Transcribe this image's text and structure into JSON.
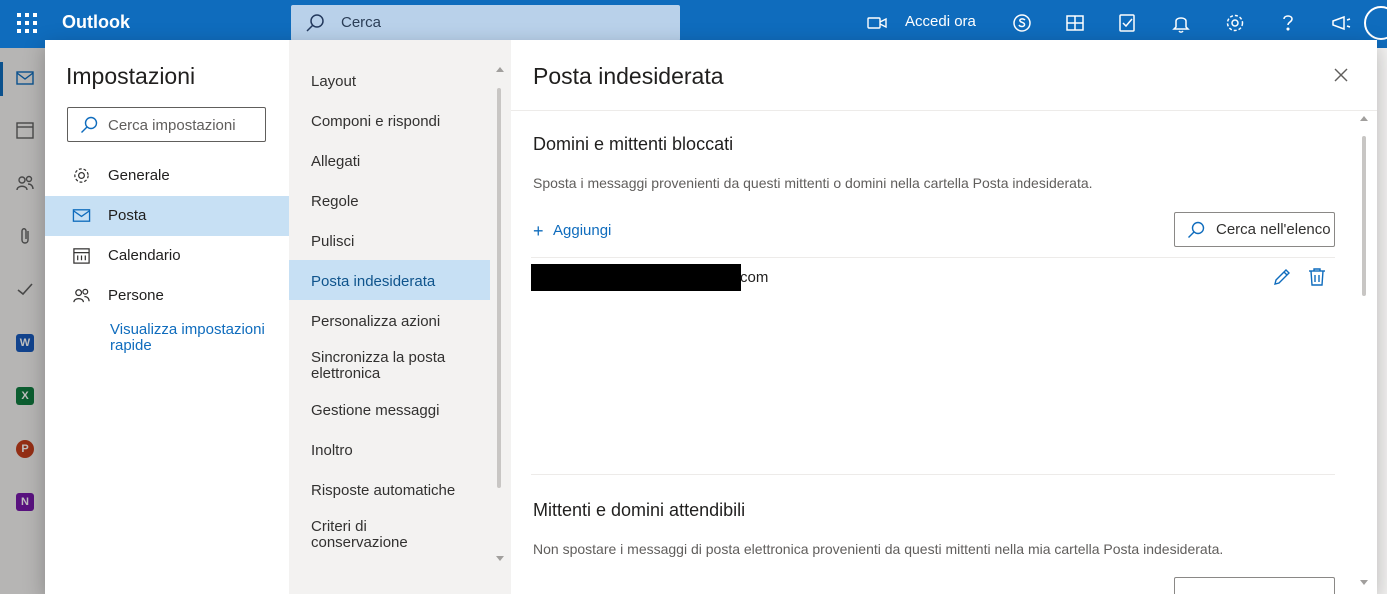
{
  "app": {
    "name": "Outlook",
    "search_placeholder": "Cerca",
    "accedi_label": "Accedi ora"
  },
  "settings": {
    "title": "Impostazioni",
    "search_placeholder": "Cerca impostazioni",
    "categories": [
      {
        "label": "Generale",
        "icon": "gear-icon",
        "selected": false
      },
      {
        "label": "Posta",
        "icon": "mail-icon",
        "selected": true
      },
      {
        "label": "Calendario",
        "icon": "calendar-icon",
        "selected": false
      },
      {
        "label": "Persone",
        "icon": "people-icon",
        "selected": false
      }
    ],
    "quick_link": "Visualizza impostazioni rapide"
  },
  "mail_sections": [
    "Layout",
    "Componi e rispondi",
    "Allegati",
    "Regole",
    "Pulisci",
    "Posta indesiderata",
    "Personalizza azioni",
    "Sincronizza la posta elettronica",
    "Gestione messaggi",
    "Inoltro",
    "Risposte automatiche",
    "Criteri di conservazione"
  ],
  "selected_section": "Posta indesiderata",
  "panel": {
    "title": "Posta indesiderata",
    "blocked": {
      "title": "Domini e mittenti bloccati",
      "description": "Sposta i messaggi provenienti da questi mittenti o domini nella cartella Posta indesiderata.",
      "add_label": "Aggiungi",
      "search_placeholder": "Cerca nell'elenco",
      "entries": [
        {
          "suffix": "com"
        }
      ]
    },
    "safe": {
      "title": "Mittenti e domini attendibili",
      "description": "Non spostare i messaggi di posta elettronica provenienti da questi mittenti nella mia cartella Posta indesiderata."
    }
  },
  "colors": {
    "accent": "#0f6cbd",
    "selected_bg": "#c7e0f4"
  }
}
